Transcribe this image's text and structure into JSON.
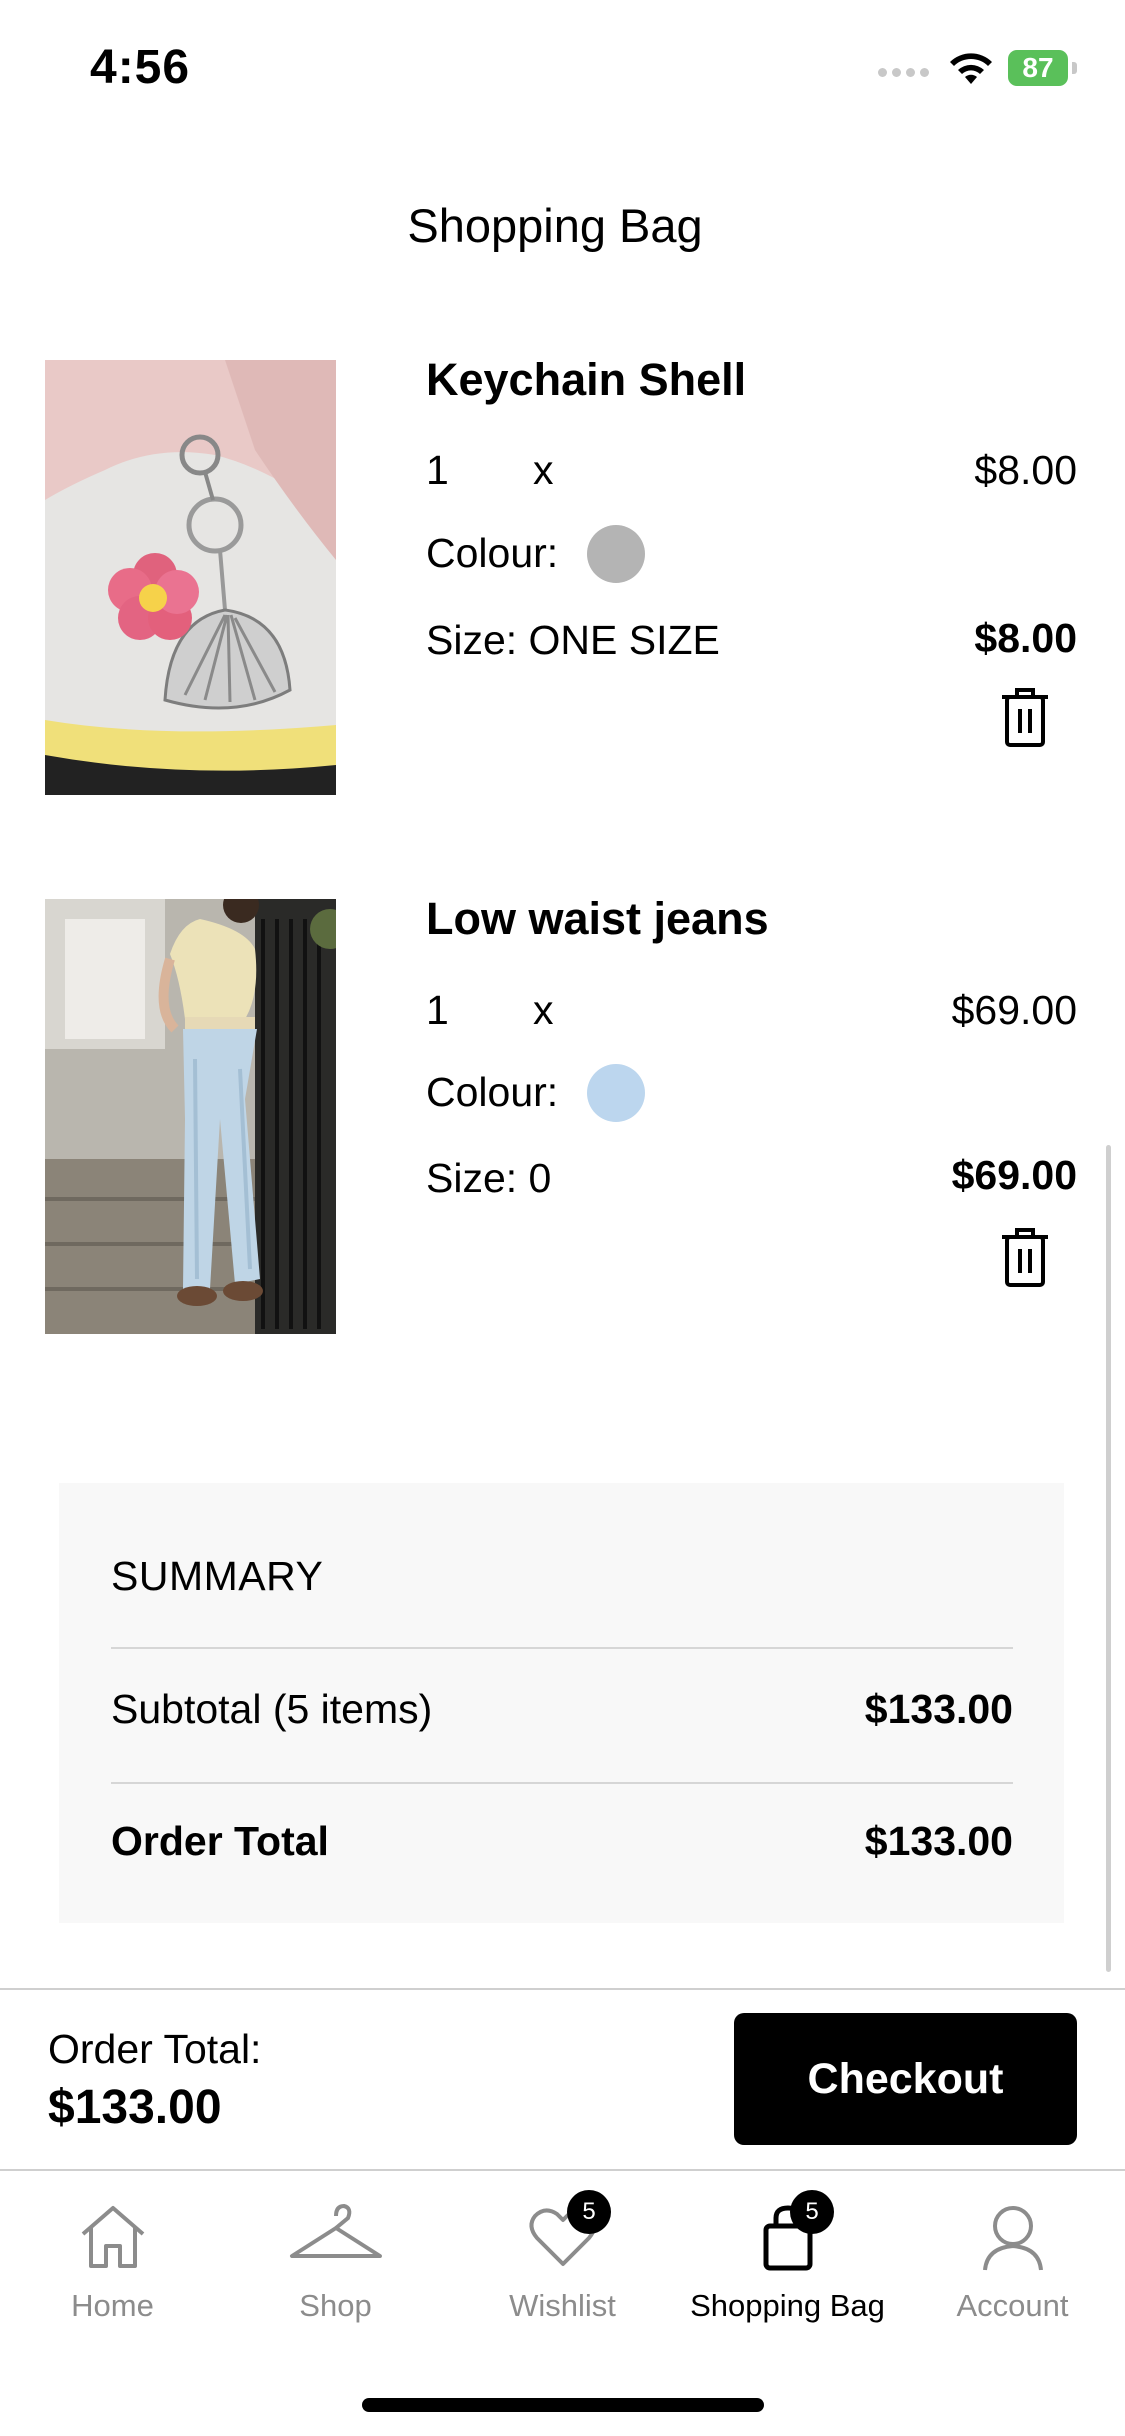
{
  "status_bar": {
    "time": "4:56",
    "battery": "87"
  },
  "page": {
    "title": "Shopping Bag"
  },
  "items": [
    {
      "name": "Keychain Shell",
      "qty": "1",
      "x": "x",
      "unit_price": "$8.00",
      "colour_label": "Colour:",
      "colour": "#b4b4b4",
      "size": "Size: ONE SIZE",
      "total": "$8.00"
    },
    {
      "name": "Low waist jeans",
      "qty": "1",
      "x": "x",
      "unit_price": "$69.00",
      "colour_label": "Colour:",
      "colour": "#bcd6ee",
      "size": "Size: 0",
      "total": "$69.00"
    }
  ],
  "summary": {
    "title": "SUMMARY",
    "subtotal_label": "Subtotal (5 items)",
    "subtotal": "$133.00",
    "total_label": "Order Total",
    "total": "$133.00"
  },
  "footer": {
    "order_total_label": "Order Total:",
    "order_total": "$133.00",
    "checkout_label": "Checkout"
  },
  "nav": {
    "items": [
      {
        "label": "Home",
        "icon": "home-icon"
      },
      {
        "label": "Shop",
        "icon": "hanger-icon"
      },
      {
        "label": "Wishlist",
        "icon": "heart-icon",
        "badge": "5"
      },
      {
        "label": "Shopping Bag",
        "icon": "bag-icon",
        "badge": "5",
        "active": true
      },
      {
        "label": "Account",
        "icon": "user-icon"
      }
    ]
  }
}
